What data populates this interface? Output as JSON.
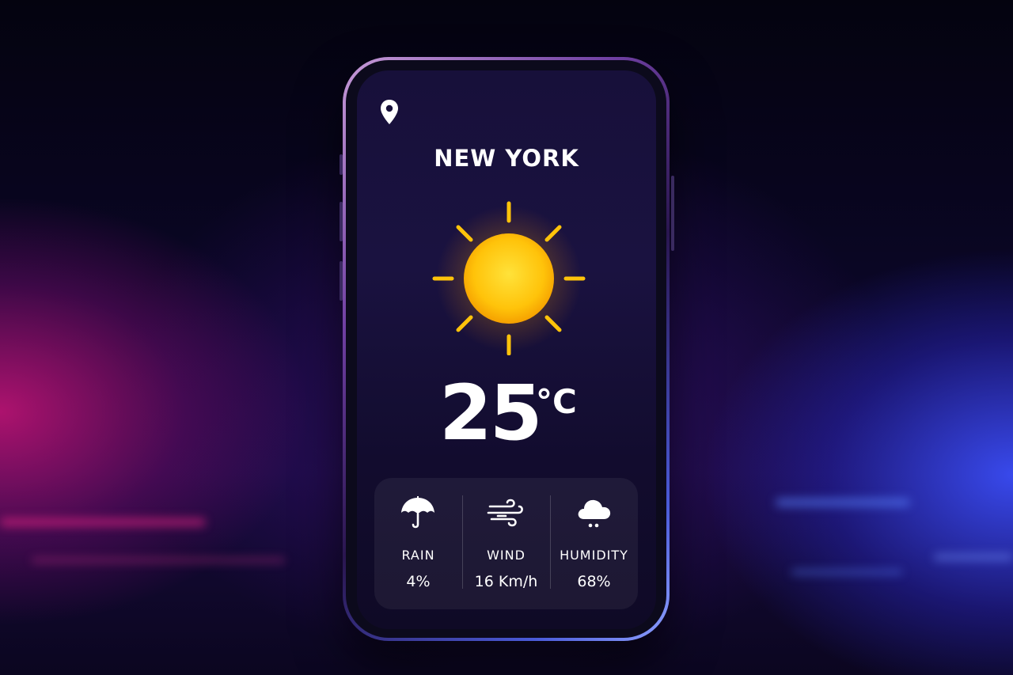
{
  "location": {
    "icon": "map-pin-icon",
    "city": "NEW YORK"
  },
  "weather": {
    "condition_icon": "sun-icon",
    "temperature": "25",
    "unit": "°C"
  },
  "stats": [
    {
      "icon": "umbrella-icon",
      "label": "RAIN",
      "value": "4%"
    },
    {
      "icon": "wind-icon",
      "label": "WIND",
      "value": "16 Km/h"
    },
    {
      "icon": "cloud-rain-icon",
      "label": "HUMIDITY",
      "value": "68%"
    }
  ],
  "colors": {
    "sun": "#FFC30A",
    "text": "#FFFFFF",
    "screen": "#17103A"
  }
}
